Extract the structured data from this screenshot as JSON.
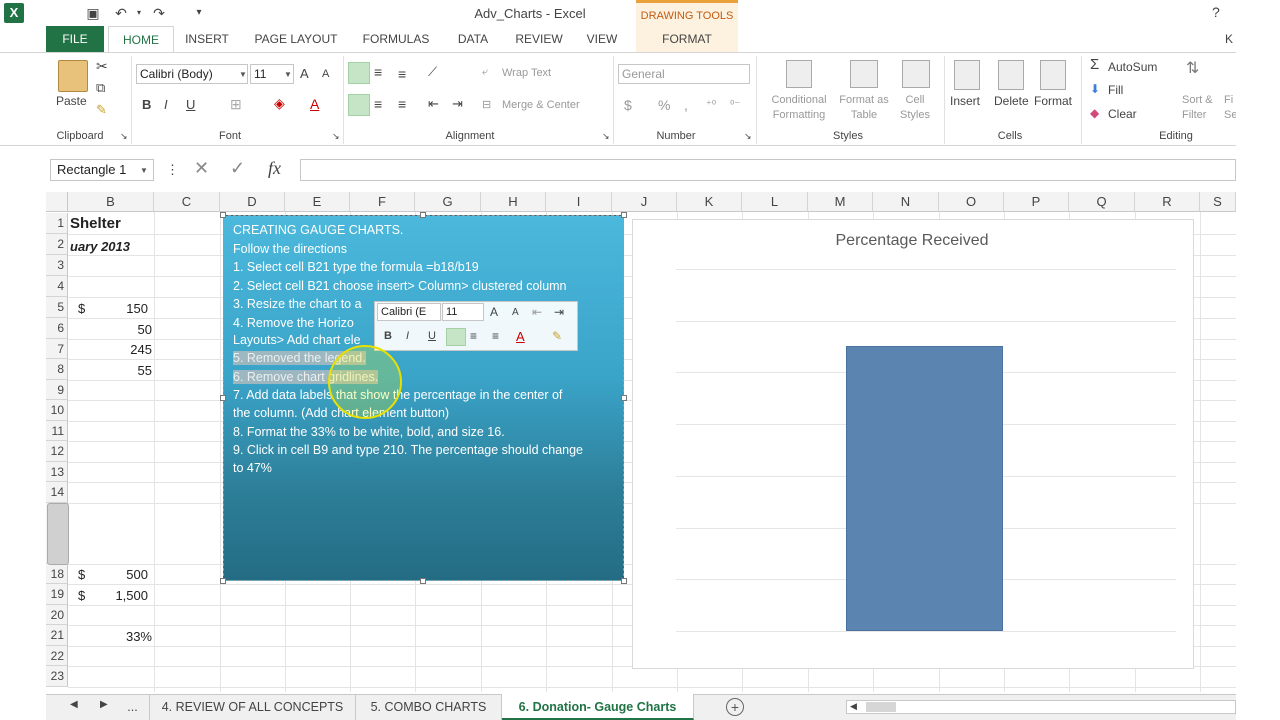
{
  "title": "Adv_Charts - Excel",
  "drawing_tools": "DRAWING TOOLS",
  "help": "?",
  "user_initials": "K",
  "tabs": {
    "file": "FILE",
    "home": "HOME",
    "insert": "INSERT",
    "page_layout": "PAGE LAYOUT",
    "formulas": "FORMULAS",
    "data": "DATA",
    "review": "REVIEW",
    "view": "VIEW",
    "format": "FORMAT"
  },
  "ribbon": {
    "clipboard": {
      "paste": "Paste",
      "label": "Clipboard"
    },
    "font": {
      "name": "Calibri (Body)",
      "size": "11",
      "bold": "B",
      "italic": "I",
      "underline": "U",
      "grow": "A",
      "shrink": "A",
      "label": "Font"
    },
    "alignment": {
      "wrap": "Wrap Text",
      "merge": "Merge & Center",
      "label": "Alignment"
    },
    "number": {
      "format": "General",
      "currency": "$",
      "percent": "%",
      "comma": ",",
      "label": "Number"
    },
    "styles": {
      "cond1": "Conditional",
      "cond2": "Formatting",
      "fmt1": "Format as",
      "fmt2": "Table",
      "cell1": "Cell",
      "cell2": "Styles",
      "label": "Styles"
    },
    "cells": {
      "insert": "Insert",
      "delete": "Delete",
      "format": "Format",
      "label": "Cells"
    },
    "editing": {
      "autosum": "AutoSum",
      "fill": "Fill",
      "clear": "Clear",
      "sort1": "Sort &",
      "sort2": "Filter",
      "find1": "Fi",
      "find2": "Se",
      "label": "Editing"
    }
  },
  "formula_bar": {
    "namebox": "Rectangle 1",
    "fx": "fx",
    "cancel": "✕",
    "enter": "✓",
    "value": ""
  },
  "columns": [
    "B",
    "C",
    "D",
    "E",
    "F",
    "G",
    "H",
    "I",
    "J",
    "K",
    "L",
    "M",
    "N",
    "O",
    "P",
    "Q",
    "R",
    "S"
  ],
  "rows": [
    "1",
    "2",
    "3",
    "4",
    "5",
    "6",
    "7",
    "8",
    "9",
    "10",
    "11",
    "12",
    "13",
    "14",
    "18",
    "19",
    "20",
    "21",
    "22",
    "23"
  ],
  "cells": {
    "b1": "Shelter",
    "b2": "uary 2013",
    "b5_cur": "$",
    "b5": "150",
    "b6": "50",
    "b7": "245",
    "b8": "55",
    "b18_cur": "$",
    "b18": "500",
    "b19_cur": "$",
    "b19": "1,500",
    "b21": "33%"
  },
  "shape_lines": [
    "CREATING GAUGE CHARTS.",
    "Follow the directions",
    "1.  Select cell B21 type the formula =b18/b19",
    "2. Select cell B21 choose insert> Column> clustered column",
    "3. Resize the chart to a",
    "4. Remove the Horizo",
    "Layouts> Add chart ele",
    "5. Removed the legend.",
    "6. Remove chart gridlines.",
    "7. Add data labels that show the percentage in the center of",
    "the column. (Add chart element button)",
    "8. Format the 33% to be white, bold, and size 16.",
    "9. Click in cell B9 and type 210. The percentage should change",
    "to 47%"
  ],
  "mini_toolbar": {
    "font": "Calibri (E",
    "size": "11",
    "bold": "B",
    "italic": "I",
    "underline": "U",
    "font_color": "A"
  },
  "chart_data": {
    "type": "bar",
    "title": "Percentage Received",
    "categories": [
      ""
    ],
    "values": [
      0.33
    ],
    "ylim": [
      0,
      0.4
    ],
    "grid": true,
    "gridlines": 7,
    "bar_color": "#5b84b1"
  },
  "sheet_tabs": {
    "more": "...",
    "t1": "4. REVIEW OF ALL CONCEPTS",
    "t2": "5. COMBO CHARTS",
    "t3": "6. Donation- Gauge Charts",
    "add": "+"
  },
  "colors": {
    "excel_green": "#217346",
    "shape_top": "#4bb8dc",
    "shape_bottom": "#246c84"
  }
}
